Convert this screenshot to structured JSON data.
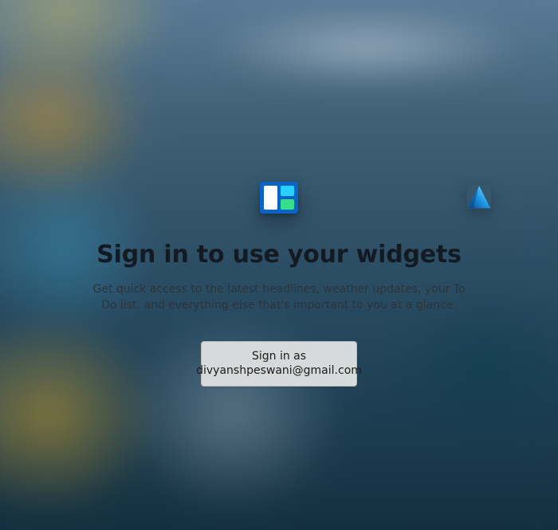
{
  "dialog": {
    "heading": "Sign in to use your widgets",
    "subtext": "Get quick access to the latest headlines, weather updates, your To Do list, and everything else that's important to you at a glance.",
    "signin_label": "Sign in as",
    "signin_account": "divyanshpeswani@gmail.com"
  },
  "icons": {
    "widgets": "widgets-icon",
    "corner_watermark": "app-watermark-icon"
  },
  "colors": {
    "widgets_bg": "#0b63c5",
    "button_bg": "#d7d9da",
    "heading_text": "#131a22",
    "body_text": "#2b343a"
  }
}
